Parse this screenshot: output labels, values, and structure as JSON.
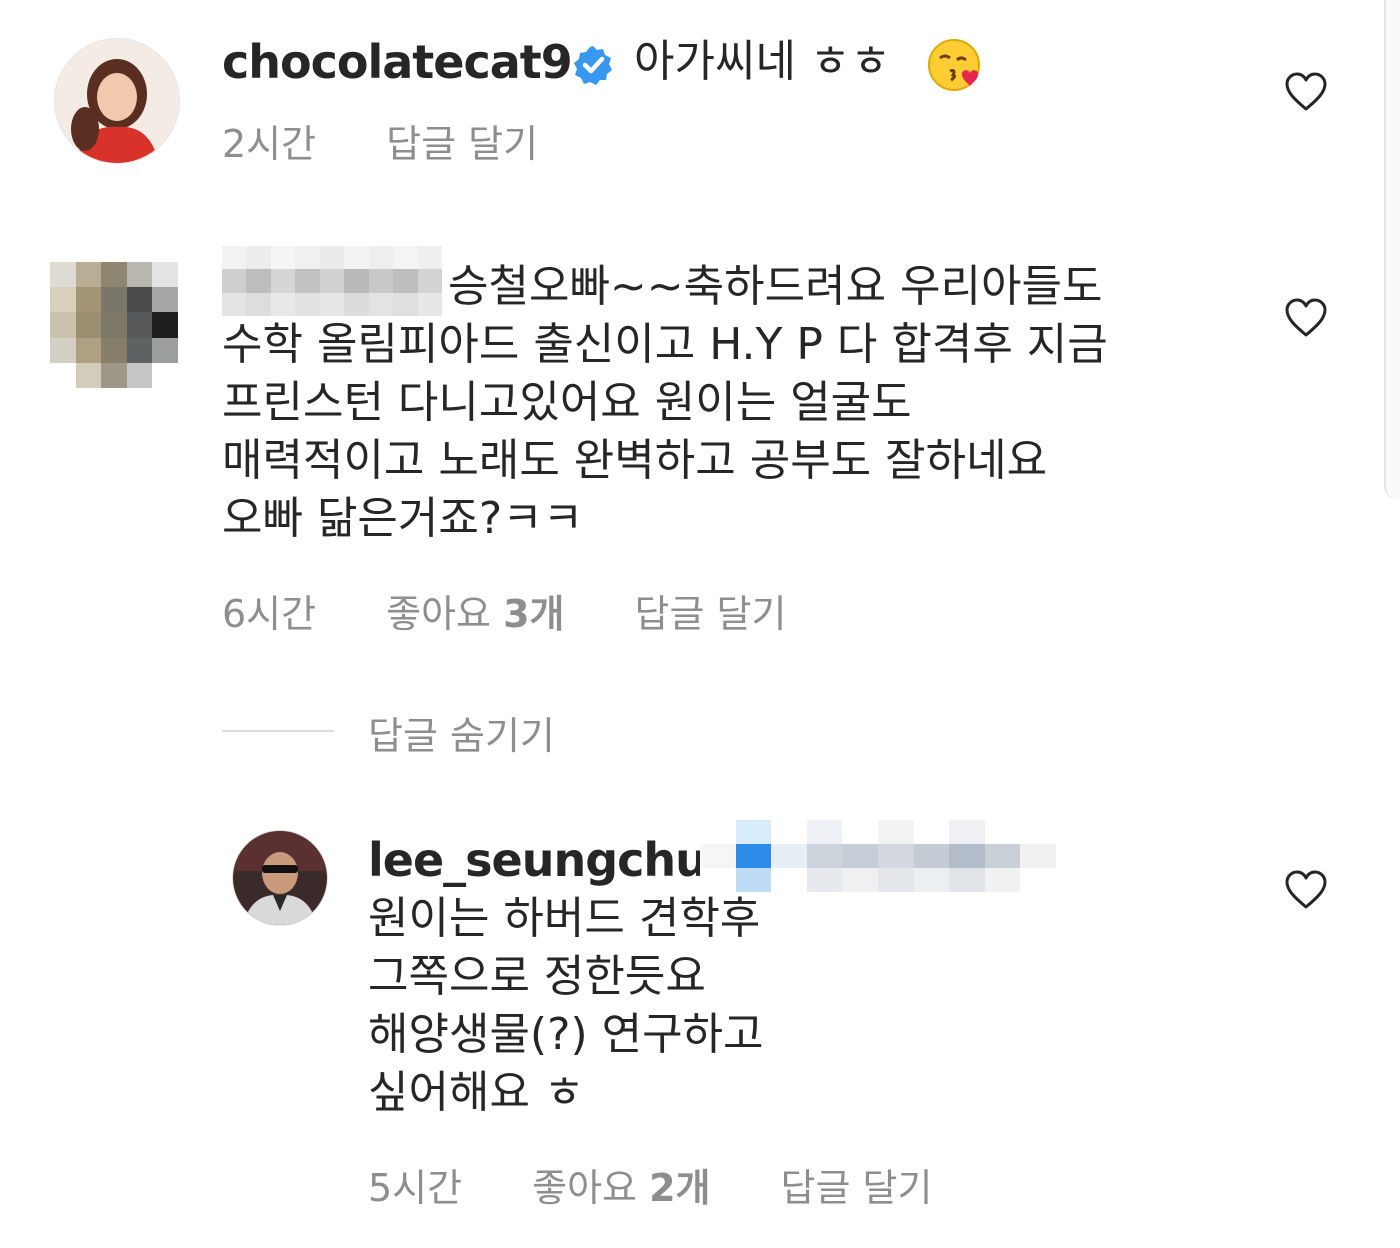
{
  "comments": [
    {
      "username": "chocolatecat9",
      "verified": true,
      "text": "아가씨네 ㅎㅎ",
      "emoji": "😘",
      "time": "2시간",
      "reply_label": "답글 달기"
    },
    {
      "username_hidden": true,
      "lines": [
        "승철오빠~~축하드려요 우리아들도",
        "수학 올림피아드 출신이고 H.Y P 다 합격후 지금",
        "프린스턴 다니고있어요 원이는 얼굴도",
        "매력적이고 노래도 완벽하고 공부도 잘하네요",
        "오빠 닮은거죠?ㅋㅋ"
      ],
      "time": "6시간",
      "likes": "좋아요 3개",
      "reply_label": "답글 달기"
    }
  ],
  "hide_replies_label": "답글 숨기기",
  "reply": {
    "username": "lee_seungchul",
    "lines": [
      "원이는 하버드 견학후",
      "그쪽으로 정한듯요",
      "해양생물(?) 연구하고",
      "싶어해요 ㅎ"
    ],
    "time": "5시간",
    "likes": "좋아요 2개",
    "reply_label": "답글 달기"
  },
  "colors": {
    "text": "#262626",
    "secondary": "#8e8e8e",
    "verified": "#3897f0",
    "divider": "#dbdbdb"
  },
  "icons": [
    "heart-icon",
    "verified-badge-icon"
  ]
}
